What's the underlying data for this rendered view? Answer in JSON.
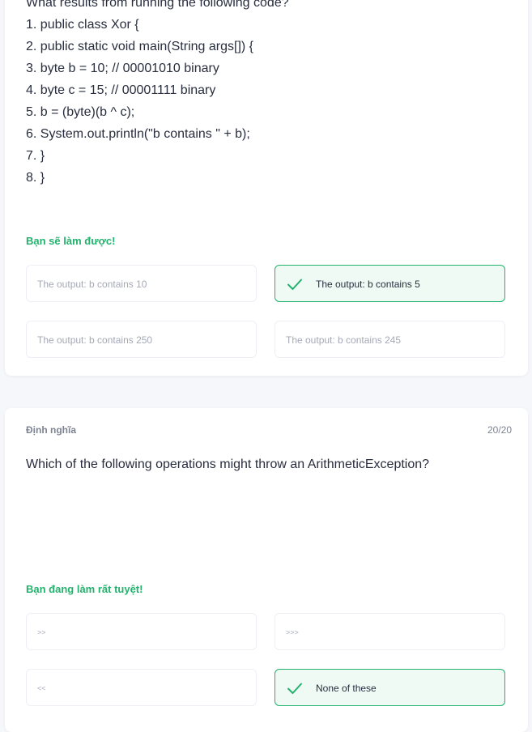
{
  "q1": {
    "prompt": "What results from running the following code?",
    "lines": [
      "1. public class Xor {",
      "2. public static void main(String args[]) {",
      "3. byte b = 10; // 00001010 binary",
      "4. byte c = 15; // 00001111 binary",
      "5. b = (byte)(b ^ c);",
      "6. System.out.println(\"b contains \" + b);",
      "7. }",
      "8. }"
    ],
    "feedback": "Bạn sẽ làm được!",
    "options": [
      {
        "label": "The output: b contains 10",
        "selected_correct": false
      },
      {
        "label": "The output: b contains 5",
        "selected_correct": true
      },
      {
        "label": "The output: b contains 250",
        "selected_correct": false
      },
      {
        "label": "The output: b contains 245",
        "selected_correct": false
      }
    ]
  },
  "q2": {
    "term_label": "Định nghĩa",
    "counter": "20/20",
    "prompt": "Which of the following operations might throw an ArithmeticException?",
    "feedback": "Bạn đang làm rất tuyệt!",
    "options": [
      {
        "label": ">>",
        "selected_correct": false
      },
      {
        "label": ">>>",
        "selected_correct": false
      },
      {
        "label": "<<",
        "selected_correct": false
      },
      {
        "label": "None of these",
        "selected_correct": true
      }
    ]
  },
  "colors": {
    "success": "#23b26d",
    "success_bg": "#effaf4",
    "text": "#282e3e",
    "muted": "#a5a9b6",
    "border": "#edeff4",
    "page_bg": "#f6f7fb"
  },
  "icons": {
    "correct_marker": "checkmark-icon"
  }
}
